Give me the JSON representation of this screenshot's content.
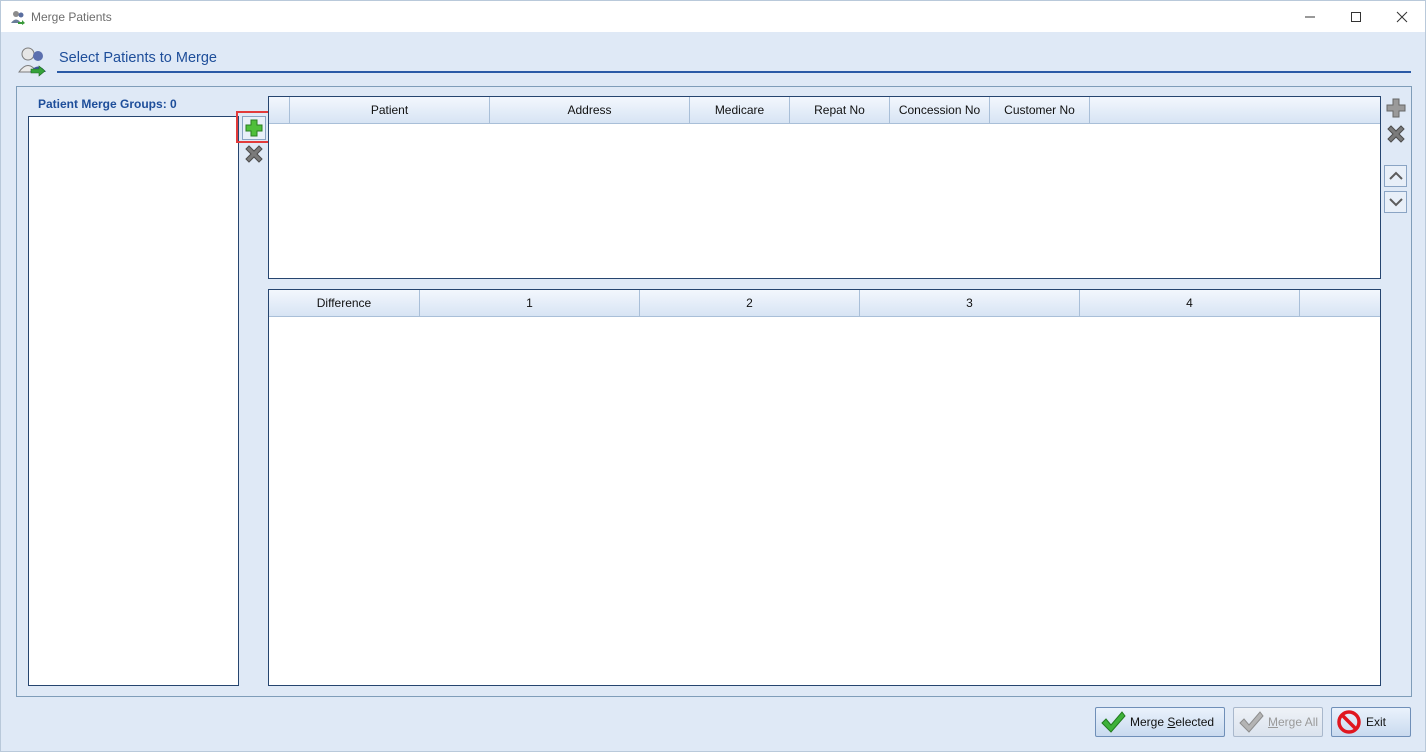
{
  "window": {
    "title": "Merge Patients"
  },
  "header": {
    "title": "Select Patients to Merge"
  },
  "groups": {
    "label": "Patient Merge Groups: 0",
    "items": []
  },
  "patients_table": {
    "columns": [
      "",
      "Patient",
      "Address",
      "Medicare",
      "Repat No",
      "Concession No",
      "Customer No"
    ],
    "rows": []
  },
  "difference_table": {
    "columns": [
      "Difference",
      "1",
      "2",
      "3",
      "4"
    ],
    "rows": []
  },
  "footer": {
    "merge_selected_pre": "Merge ",
    "merge_selected_key": "S",
    "merge_selected_post": "elected",
    "merge_all_pre": "",
    "merge_all_key": "M",
    "merge_all_post": "erge All",
    "exit": "Exit"
  },
  "colors": {
    "accent": "#1e4e9a",
    "highlight": "#e23b3b",
    "background": "#dfe9f6"
  },
  "icons": [
    "patients-icon",
    "add-icon",
    "delete-icon",
    "move-up-icon",
    "move-down-icon",
    "check-icon",
    "no-entry-icon"
  ]
}
